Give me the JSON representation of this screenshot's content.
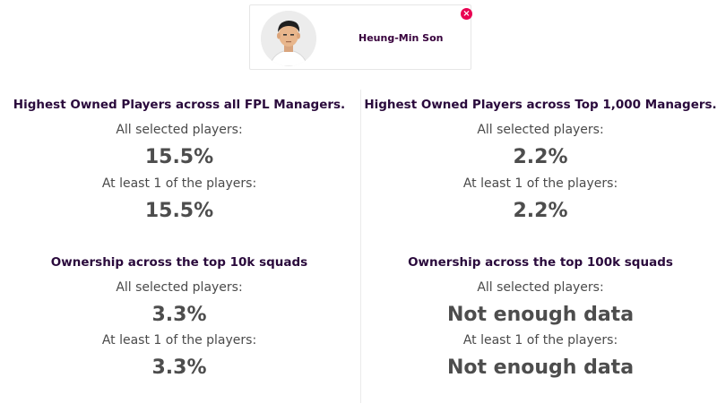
{
  "player_card": {
    "name": "Heung-Min Son",
    "remove_icon": "×"
  },
  "sections": [
    {
      "title": "Highest Owned Players across all FPL Managers.",
      "all_label": "All selected players:",
      "all_value": "15.5%",
      "atleast_label": "At least 1 of the players:",
      "atleast_value": "15.5%"
    },
    {
      "title": "Highest Owned Players across Top 1,000 Managers.",
      "all_label": "All selected players:",
      "all_value": "2.2%",
      "atleast_label": "At least 1 of the players:",
      "atleast_value": "2.2%"
    },
    {
      "title": "Ownership across the top 10k squads",
      "all_label": "All selected players:",
      "all_value": "3.3%",
      "atleast_label": "At least 1 of the players:",
      "atleast_value": "3.3%"
    },
    {
      "title": "Ownership across the top 100k squads",
      "all_label": "All selected players:",
      "all_value": "Not enough data",
      "atleast_label": "At least 1 of the players:",
      "atleast_value": "Not enough data"
    }
  ]
}
